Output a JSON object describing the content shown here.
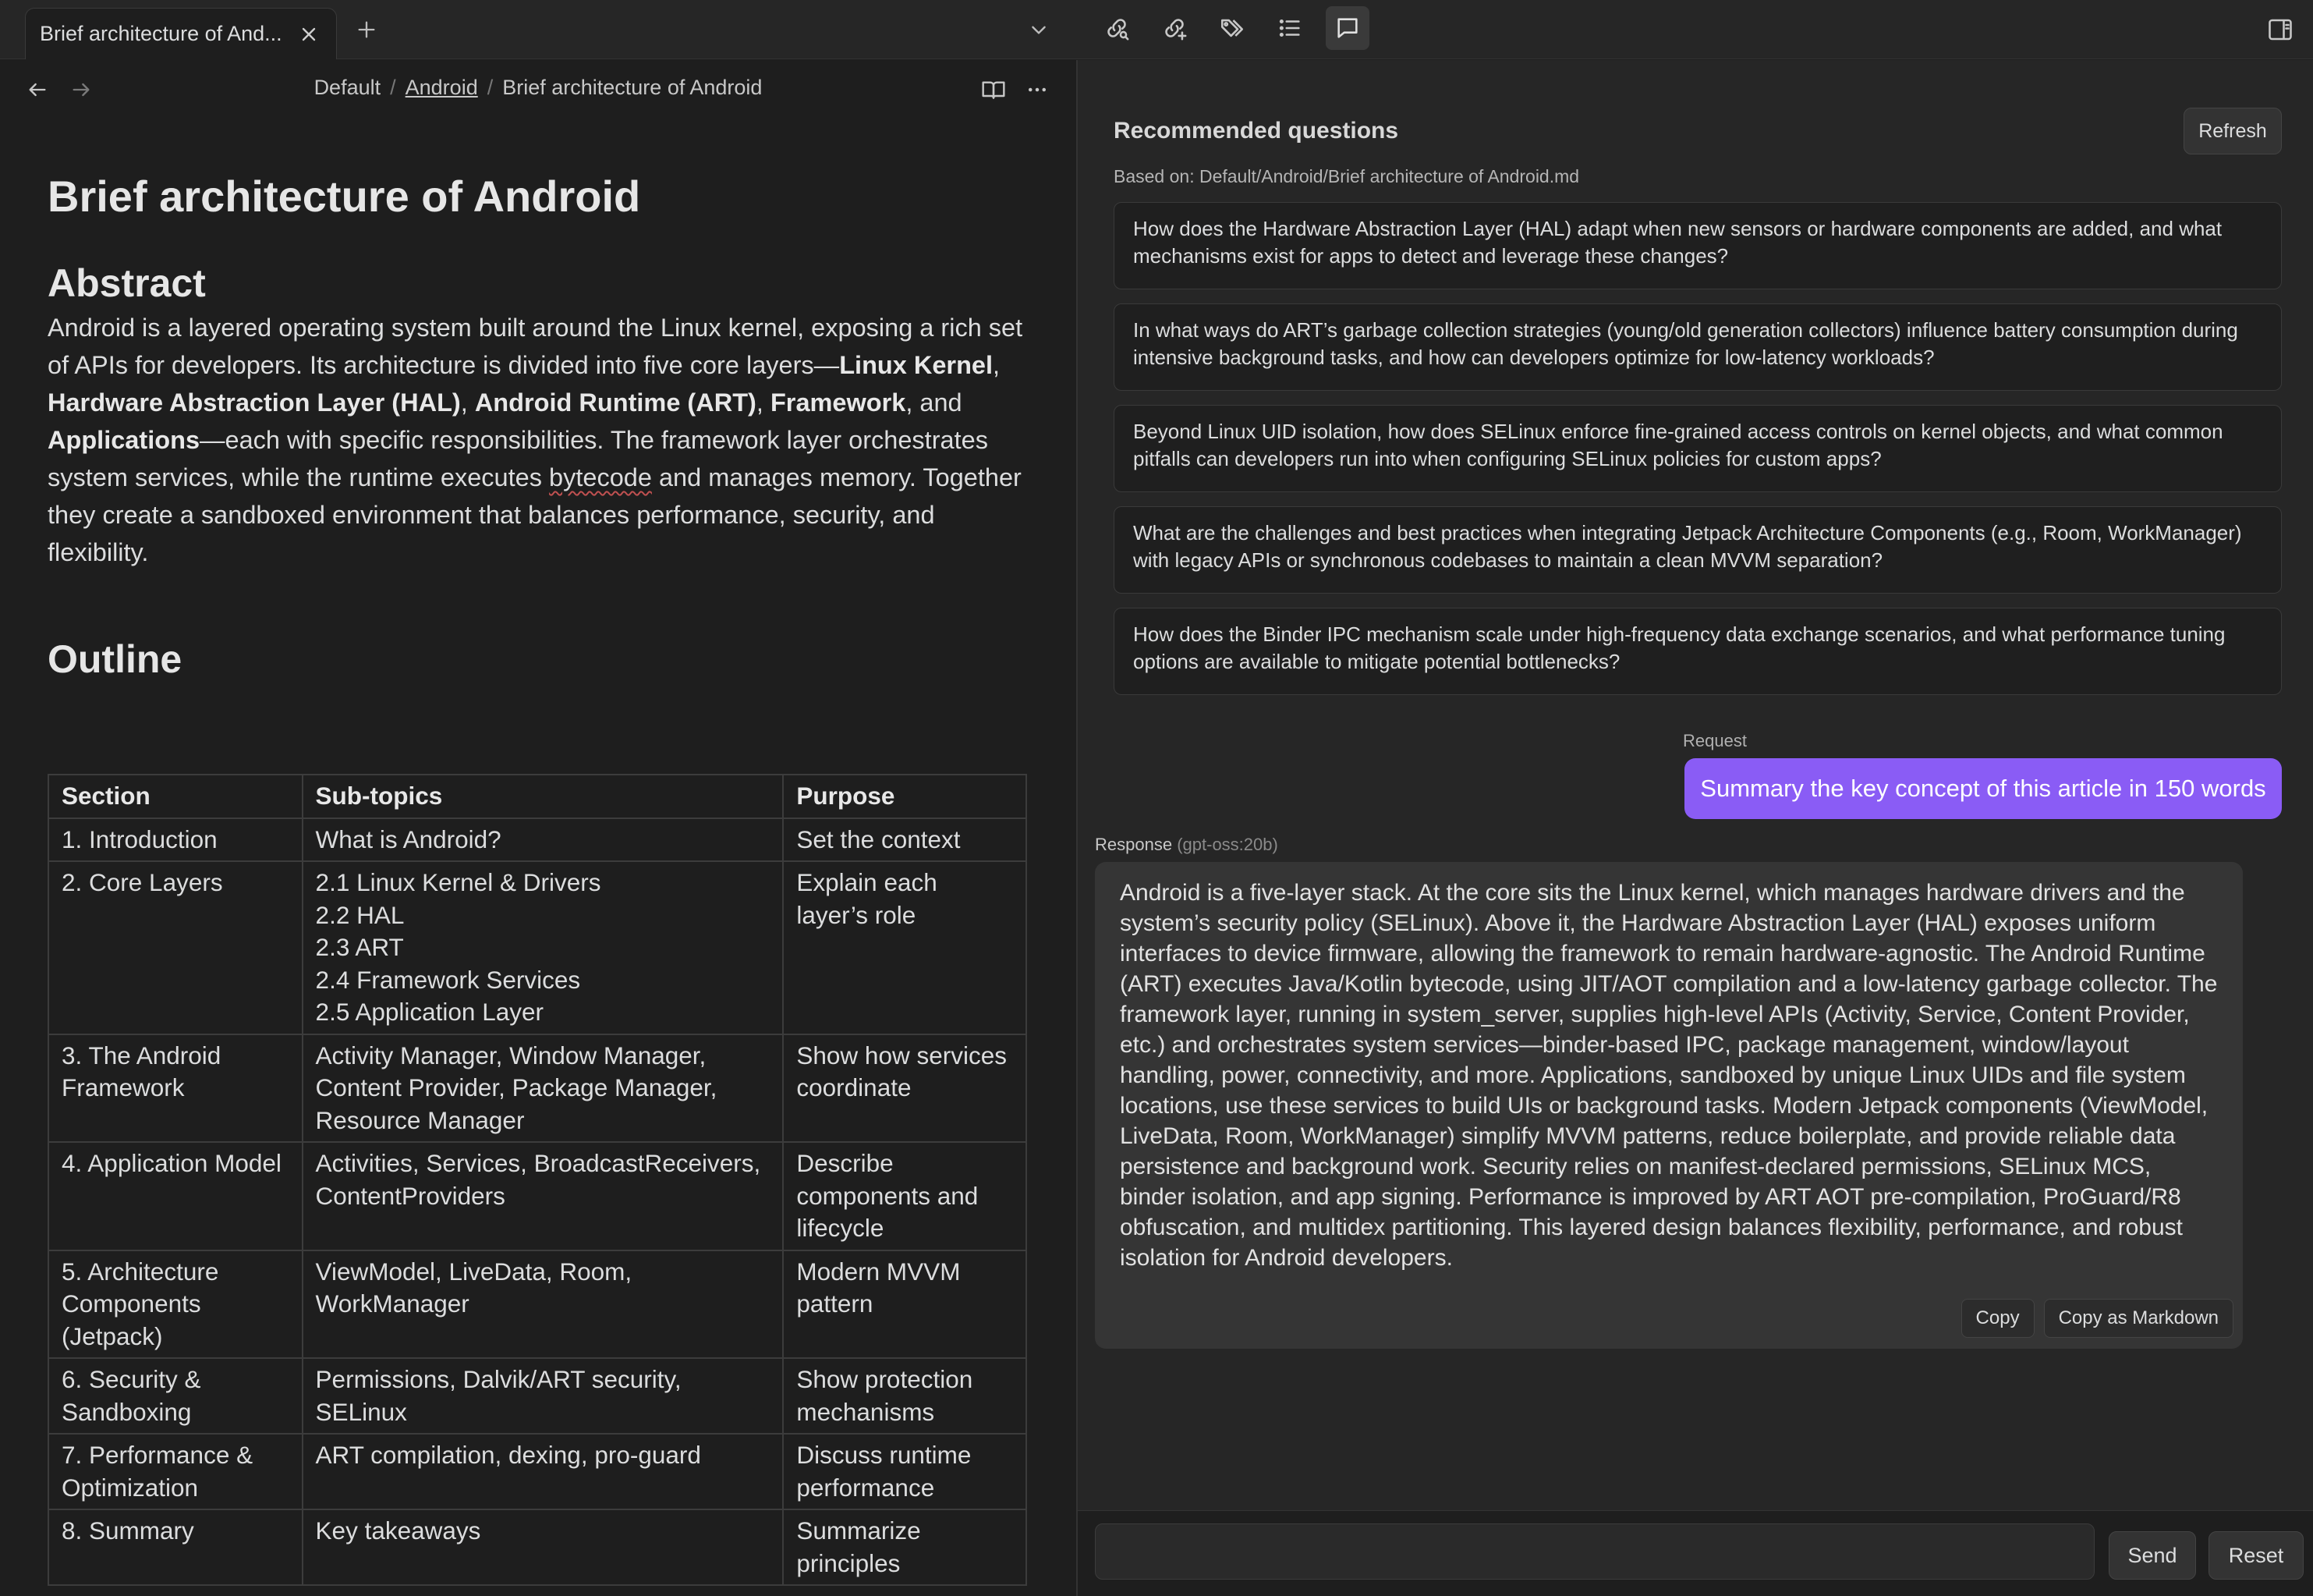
{
  "tab": {
    "title": "Brief architecture of And..."
  },
  "breadcrumb": {
    "root": "Default",
    "folder": "Android",
    "current": "Brief architecture of Android"
  },
  "doc": {
    "title": "Brief architecture of Android",
    "abstract_heading": "Abstract",
    "abstract": {
      "p1": "Android is a layered operating system built around the Linux kernel, exposing a rich set of APIs for developers. Its architecture is divided into five core layers—",
      "b1": "Linux Kernel",
      "s1": ", ",
      "b2": "Hardware Abstraction Layer (HAL)",
      "s2": ", ",
      "b3": "Android Runtime (ART)",
      "s3": ", ",
      "b4": "Framework",
      "s4": ", and ",
      "b5": "Applications",
      "p2": "—each with specific responsibilities. The framework layer orchestrates system services, while the runtime executes ",
      "squiggle": "bytecode",
      "p3": " and manages memory. Together they create a sandboxed environment that balances performance, security, and flexibility."
    },
    "outline_heading": "Outline",
    "table": {
      "headers": [
        "Section",
        "Sub-topics",
        "Purpose"
      ],
      "rows": [
        [
          "1. Introduction",
          "What is Android?",
          "Set the context"
        ],
        [
          "2. Core Layers",
          "2.1 Linux Kernel & Drivers\n2.2 HAL\n2.3 ART\n2.4 Framework Services\n2.5 Application Layer",
          "Explain each layer’s role"
        ],
        [
          "3. The Android Framework",
          "Activity Manager, Window Manager, Content Provider, Package Manager, Resource Manager",
          "Show how services coordinate"
        ],
        [
          "4. Application Model",
          "Activities, Services, BroadcastReceivers, ContentProviders",
          "Describe components and lifecycle"
        ],
        [
          "5. Architecture Components (Jetpack)",
          "ViewModel, LiveData, Room, WorkManager",
          "Modern MVVM pattern"
        ],
        [
          "6. Security & Sandboxing",
          "Permissions, Dalvik/ART security, SELinux",
          "Show protection mechanisms"
        ],
        [
          "7. Performance & Optimization",
          "ART compilation, dexing, pro-guard",
          "Discuss runtime performance"
        ],
        [
          "8. Summary",
          "Key takeaways",
          "Summarize principles"
        ]
      ]
    }
  },
  "panel": {
    "title": "Recommended questions",
    "refresh_label": "Refresh",
    "based_on": "Based on: Default/Android/Brief architecture of Android.md",
    "questions": [
      "How does the Hardware Abstraction Layer (HAL) adapt when new sensors or hardware components are added, and what mechanisms exist for apps to detect and leverage these changes?",
      "In what ways do ART’s garbage collection strategies (young/old generation collectors) influence battery consumption during intensive background tasks, and how can developers optimize for low-latency workloads?",
      "Beyond Linux UID isolation, how does SELinux enforce fine-grained access controls on kernel objects, and what common pitfalls can developers run into when configuring SELinux policies for custom apps?",
      "What are the challenges and best practices when integrating Jetpack Architecture Components (e.g., Room, WorkManager) with legacy APIs or synchronous codebases to maintain a clean MVVM separation?",
      "How does the Binder IPC mechanism scale under high-frequency data exchange scenarios, and what performance tuning options are available to mitigate potential bottlenecks?"
    ],
    "request_label": "Request",
    "request_text": "Summary the key concept of this article in 150 words",
    "response_label": "Response",
    "response_model": "(gpt-oss:20b)",
    "response_text": "Android is a five-layer stack. At the core sits the Linux kernel, which manages hardware drivers and the system’s security policy (SELinux). Above it, the Hardware Abstraction Layer (HAL) exposes uniform interfaces to device firmware, allowing the framework to remain hardware-agnostic. The Android Runtime (ART) executes Java/Kotlin bytecode, using JIT/AOT compilation and a low-latency garbage collector. The framework layer, running in system_server, supplies high-level APIs (Activity, Service, Content Provider, etc.) and orchestrates system services—binder-based IPC, package management, window/layout handling, power, connectivity, and more. Applications, sandboxed by unique Linux UIDs and file system locations, use these services to build UIs or background tasks. Modern Jetpack components (ViewModel, LiveData, Room, WorkManager) simplify MVVM patterns, reduce boilerplate, and provide reliable data persistence and background work. Security relies on manifest-declared permissions, SELinux MCS, binder isolation, and app signing. Performance is improved by ART AOT pre-compilation, ProGuard/R8 obfuscation, and multidex partitioning. This layered design balances flexibility, performance, and robust isolation for Android developers.",
    "copy_label": "Copy",
    "copy_md_label": "Copy as Markdown",
    "input_placeholder": "",
    "send_label": "Send",
    "reset_label": "Reset"
  },
  "icons": {
    "tab_close": "close-icon",
    "new_tab": "plus-icon",
    "tab_list": "chevron-down-icon",
    "toolbar": [
      "link-search-icon",
      "link-add-icon",
      "tags-icon",
      "list-icon",
      "chat-icon"
    ],
    "sidebar": "sidebar-toggle-icon",
    "back": "arrow-left-icon",
    "forward": "arrow-right-icon",
    "reading": "book-open-icon",
    "more": "more-horizontal-icon"
  },
  "colors": {
    "accent": "#8a5cf5",
    "background": "#1e1e1e",
    "panel": "#262626",
    "response_bg": "#353535"
  }
}
